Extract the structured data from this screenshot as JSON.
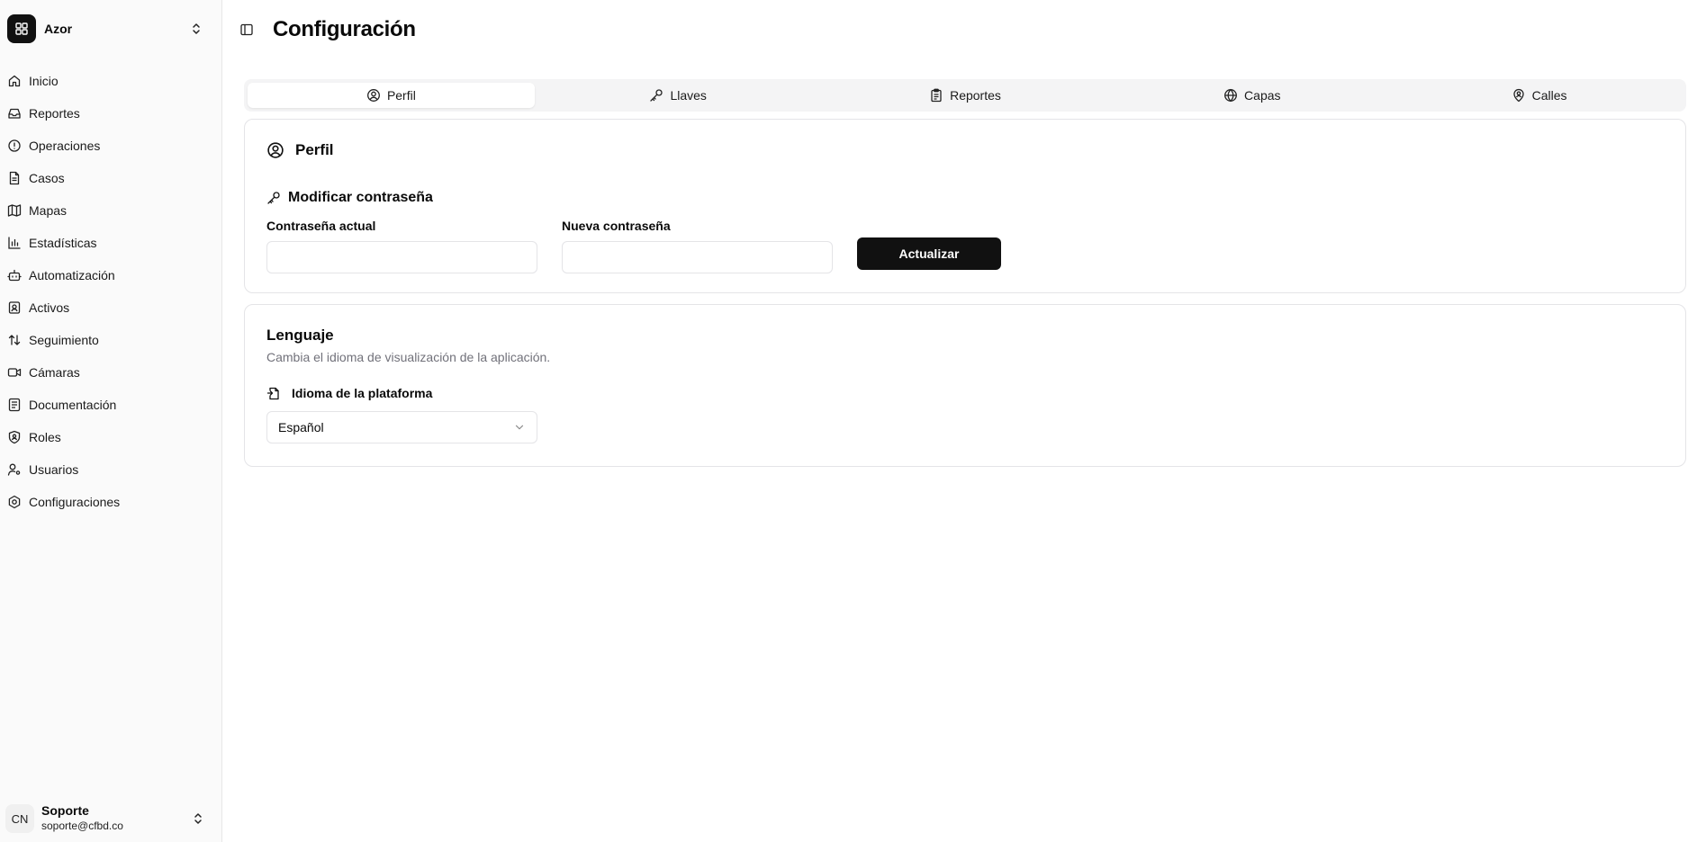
{
  "brand": {
    "name": "Azor"
  },
  "sidebar": {
    "items": [
      {
        "label": "Inicio"
      },
      {
        "label": "Reportes"
      },
      {
        "label": "Operaciones"
      },
      {
        "label": "Casos"
      },
      {
        "label": "Mapas"
      },
      {
        "label": "Estadísticas"
      },
      {
        "label": "Automatización"
      },
      {
        "label": "Activos"
      },
      {
        "label": "Seguimiento"
      },
      {
        "label": "Cámaras"
      },
      {
        "label": "Documentación"
      },
      {
        "label": "Roles"
      },
      {
        "label": "Usuarios"
      },
      {
        "label": "Configuraciones"
      }
    ]
  },
  "user": {
    "initials": "CN",
    "name": "Soporte",
    "email": "soporte@cfbd.co"
  },
  "header": {
    "title": "Configuración"
  },
  "tabs": [
    {
      "label": "Perfil",
      "icon": "user-circle-icon",
      "active": true
    },
    {
      "label": "Llaves",
      "icon": "key-icon"
    },
    {
      "label": "Reportes",
      "icon": "clipboard-icon"
    },
    {
      "label": "Capas",
      "icon": "globe-icon"
    },
    {
      "label": "Calles",
      "icon": "map-pin-user-icon"
    }
  ],
  "profile": {
    "title": "Perfil",
    "password": {
      "title": "Modificar contraseña",
      "current_label": "Contraseña actual",
      "current_value": "",
      "new_label": "Nueva contraseña",
      "new_value": "",
      "submit_label": "Actualizar"
    }
  },
  "language": {
    "title": "Lenguaje",
    "description": "Cambia el idioma de visualización de la aplicación.",
    "field_label": "Idioma de la plataforma",
    "selected": "Español"
  },
  "colors": {
    "primary_button": "#111111",
    "sidebar_bg": "#fafafa",
    "muted_text": "#71717a",
    "border": "#e4e4e7"
  }
}
